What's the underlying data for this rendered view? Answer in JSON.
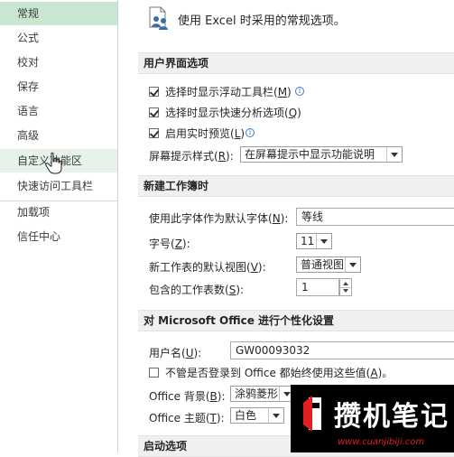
{
  "sidebar": {
    "items": [
      {
        "label": "常规"
      },
      {
        "label": "公式"
      },
      {
        "label": "校对"
      },
      {
        "label": "保存"
      },
      {
        "label": "语言"
      },
      {
        "label": "高级"
      },
      {
        "label": "自定义功能区"
      },
      {
        "label": "快速访问工具栏"
      },
      {
        "label": "加载项"
      },
      {
        "label": "信任中心"
      }
    ],
    "selected": "常规",
    "hovered": "自定义功能区"
  },
  "main": {
    "intro": "使用 Excel 时采用的常规选项。",
    "ui_section": {
      "title": "用户界面选项",
      "show_mini_toolbar": {
        "label": "选择时显示浮动工具栏(",
        "key": "M",
        "tail": ")",
        "checked": true
      },
      "show_quick_analysis": {
        "label": "选择时显示快速分析选项(",
        "key": "Q",
        "tail": ")",
        "checked": true
      },
      "live_preview": {
        "label": "启用实时预览(",
        "key": "L",
        "tail": ")",
        "checked": true
      },
      "screentip_style": {
        "label": "屏幕提示样式(",
        "key": "R",
        "tail": "):",
        "value": "在屏幕提示中显示功能说明"
      }
    },
    "new_workbook_section": {
      "title": "新建工作簿时",
      "default_font": {
        "label": "使用此字体作为默认字体(",
        "key": "N",
        "tail": "):",
        "value": "等线"
      },
      "font_size": {
        "label": "字号(",
        "key": "Z",
        "tail": "):",
        "value": "11"
      },
      "default_view": {
        "label": "新工作表的默认视图(",
        "key": "V",
        "tail": "):",
        "value": "普通视图"
      },
      "sheet_count": {
        "label": "包含的工作表数(",
        "key": "S",
        "tail": "):",
        "value": "1"
      }
    },
    "personalize_section": {
      "title": "对 Microsoft Office 进行个性化设置",
      "user_name": {
        "label": "用户名(",
        "key": "U",
        "tail": "):",
        "value": "GW00093032"
      },
      "always_use_values": {
        "label": "不管是否登录到 Office 都始终使用这些值(",
        "key": "A",
        "tail": ")。",
        "checked": false
      },
      "office_background": {
        "label": "Office 背景(",
        "key": "B",
        "tail": "):",
        "value": "涂鸦菱形"
      },
      "office_theme": {
        "label": "Office 主题(",
        "key": "T",
        "tail": "):",
        "value": "白色"
      }
    },
    "startup_section": {
      "title": "启动选项"
    }
  },
  "watermark": {
    "title": "攒机笔记",
    "url": "www.cuanjibiji.com"
  },
  "colors": {
    "selected_bg": "#c9e6d3",
    "section_bg": "#f0f0f0",
    "info_blue": "#3a7dc9",
    "watermark_red": "#e02020"
  }
}
